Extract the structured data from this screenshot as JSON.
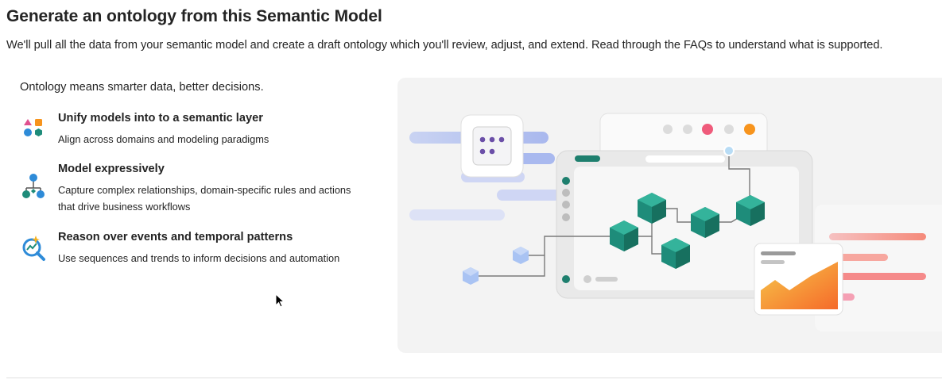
{
  "header": {
    "title": "Generate an ontology from this Semantic Model",
    "subtitle": "We'll pull all the data from your semantic model and create a draft ontology which you'll review, adjust, and extend. Read through the FAQs to understand what is supported."
  },
  "intro": "Ontology means smarter data, better decisions.",
  "features": [
    {
      "icon": "shapes-icon",
      "heading": "Unify models into to a semantic layer",
      "description": "Align across domains and modeling paradigms"
    },
    {
      "icon": "hierarchy-icon",
      "heading": "Model expressively",
      "description": "Capture complex relationships, domain-specific rules and actions that drive business workflows"
    },
    {
      "icon": "sparkle-search-icon",
      "heading": "Reason over events and temporal patterns",
      "description": "Use sequences and trends to inform decisions and automation"
    }
  ],
  "colors": {
    "teal": "#1e8c7a",
    "purple": "#6b4fa8",
    "accent_orange": "#f7941d",
    "accent_pink": "#ef5b7b",
    "blue": "#2e8bd8"
  }
}
